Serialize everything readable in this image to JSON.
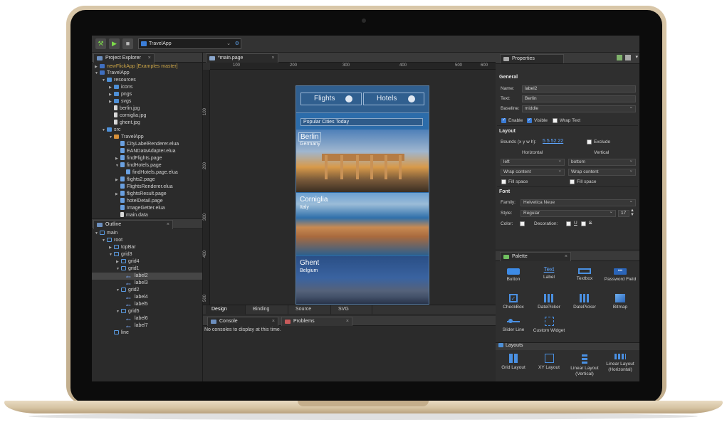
{
  "toolbar": {
    "app_selector": "TravelApp"
  },
  "project_explorer": {
    "tab_label": "Project Explorer",
    "rows": [
      {
        "label": "newFlickApp  [Examples master]",
        "icon": "project-icon"
      },
      {
        "label": "TravelApp",
        "icon": "project-icon"
      },
      {
        "label": "resources",
        "icon": "folder-icon"
      },
      {
        "label": "icons",
        "icon": "folder-icon"
      },
      {
        "label": "pngs",
        "icon": "folder-icon"
      },
      {
        "label": "svgs",
        "icon": "folder-icon"
      },
      {
        "label": "berlin.jpg",
        "icon": "file-icon"
      },
      {
        "label": "corniglia.jpg",
        "icon": "file-icon"
      },
      {
        "label": "ghent.jpg",
        "icon": "file-icon"
      },
      {
        "label": "src",
        "icon": "folder-icon"
      },
      {
        "label": "TravelApp",
        "icon": "package-icon"
      },
      {
        "label": "CityLabelRenderer.elua",
        "icon": "elua-icon"
      },
      {
        "label": "EANDataAdapter.elua",
        "icon": "elua-icon"
      },
      {
        "label": "findFlights.page",
        "icon": "page-icon"
      },
      {
        "label": "findHotels.page",
        "icon": "page-icon"
      },
      {
        "label": "findHotels.page.elua",
        "icon": "elua-icon"
      },
      {
        "label": "flights2.page",
        "icon": "page-icon"
      },
      {
        "label": "FlightsRenderer.elua",
        "icon": "elua-icon"
      },
      {
        "label": "flightsResult.page",
        "icon": "page-icon"
      },
      {
        "label": "hotelDetail.page",
        "icon": "page-icon"
      },
      {
        "label": "ImageGetter.elua",
        "icon": "elua-icon"
      },
      {
        "label": "main.data",
        "icon": "data-icon"
      }
    ]
  },
  "outline": {
    "tab_label": "Outline",
    "rows": [
      {
        "label": "main",
        "icon": "grid-icon"
      },
      {
        "label": "root",
        "icon": "grid-icon"
      },
      {
        "label": "topBar",
        "icon": "grid-icon"
      },
      {
        "label": "grid3",
        "icon": "grid-icon"
      },
      {
        "label": "grid4",
        "icon": "grid-icon"
      },
      {
        "label": "grid1",
        "icon": "grid-icon"
      },
      {
        "label": "label2",
        "icon": "label-icon"
      },
      {
        "label": "label3",
        "icon": "label-icon"
      },
      {
        "label": "grid2",
        "icon": "grid-icon"
      },
      {
        "label": "label4",
        "icon": "label-icon"
      },
      {
        "label": "label5",
        "icon": "label-icon"
      },
      {
        "label": "grid5",
        "icon": "grid-icon"
      },
      {
        "label": "label6",
        "icon": "label-icon"
      },
      {
        "label": "label7",
        "icon": "label-icon"
      },
      {
        "label": "line",
        "icon": "grid-icon"
      }
    ]
  },
  "editor": {
    "tab_label": "*main.page",
    "ruler_h": [
      "100",
      "200",
      "300",
      "400",
      "500",
      "600"
    ],
    "ruler_v": [
      "100",
      "200",
      "300",
      "400",
      "500"
    ],
    "bottom_tabs": [
      "Design",
      "Binding",
      "Source",
      "SVG"
    ],
    "phone": {
      "tab_flights": "Flights",
      "tab_hotels": "Hotels",
      "search_text": "Popular Cities Today",
      "cities": [
        {
          "name": "Berlin",
          "country": "Germany"
        },
        {
          "name": "Corniglia",
          "country": "Italy"
        },
        {
          "name": "Ghent",
          "country": "Belgium"
        }
      ]
    }
  },
  "console": {
    "tab_console": "Console",
    "tab_problems": "Problems",
    "message": "No consoles to display at this time."
  },
  "properties": {
    "tab_label": "Properties",
    "general_title": "General",
    "name_label": "Name:",
    "name_value": "label2",
    "text_label": "Text:",
    "text_value": "Berlin",
    "baseline_label": "Baseline:",
    "baseline_value": "middle",
    "enable": "Enable",
    "visible": "Visible",
    "wrap_text": "Wrap Text",
    "layout_title": "Layout",
    "bounds_label": "Bounds (x y w h):",
    "bounds_value": "5 5 52 22",
    "exclude": "Exclude",
    "horizontal": "Horizontal",
    "vertical": "Vertical",
    "h_align": "left",
    "v_align": "bottom",
    "h_size": "Wrap content",
    "v_size": "Wrap content",
    "fill_space": "Fill space",
    "font_title": "Font",
    "family_label": "Family:",
    "family_value": "Helvetica Neue",
    "style_label": "Style:",
    "style_value": "Regular",
    "size_value": "17",
    "color_label": "Color:",
    "decoration_label": "Decoration:",
    "underline_glyph": "U",
    "strike_glyph": "S"
  },
  "palette": {
    "tab_label": "Palette",
    "items": [
      {
        "label": "Button"
      },
      {
        "label": "Label",
        "glyph": "Text"
      },
      {
        "label": "Textbox"
      },
      {
        "label": "Password Field",
        "glyph": "•••"
      },
      {
        "label": "CheckBox"
      },
      {
        "label": "DatePicker"
      },
      {
        "label": "DatePicker"
      },
      {
        "label": "Bitmap"
      },
      {
        "label": "Slider Line"
      },
      {
        "label": "Custom Widget"
      }
    ],
    "layouts_title": "Layouts",
    "layouts": [
      {
        "label": "Grid Layout"
      },
      {
        "label": "XY Layout"
      },
      {
        "label": "Linear Layout (Vertical)"
      },
      {
        "label": "Linear Layout (Horizontal)"
      }
    ]
  }
}
